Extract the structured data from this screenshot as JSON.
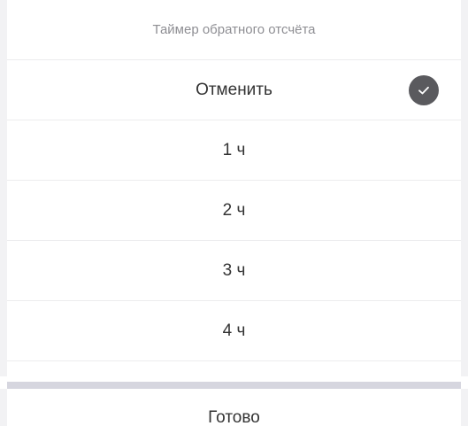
{
  "header": {
    "title": "Таймер обратного отсчёта"
  },
  "options": [
    {
      "label": "Отменить",
      "selected": true
    },
    {
      "label": "1 ч",
      "selected": false
    },
    {
      "label": "2 ч",
      "selected": false
    },
    {
      "label": "3 ч",
      "selected": false
    },
    {
      "label": "4 ч",
      "selected": false
    }
  ],
  "icons": {
    "selected_check": "checkmark-circle-icon"
  },
  "colors": {
    "text": "#333333",
    "header_text": "#8e8e93",
    "check_bg": "#5a5a5e",
    "separator": "#d6d6df"
  },
  "footer": {
    "done_label": "Готово"
  }
}
